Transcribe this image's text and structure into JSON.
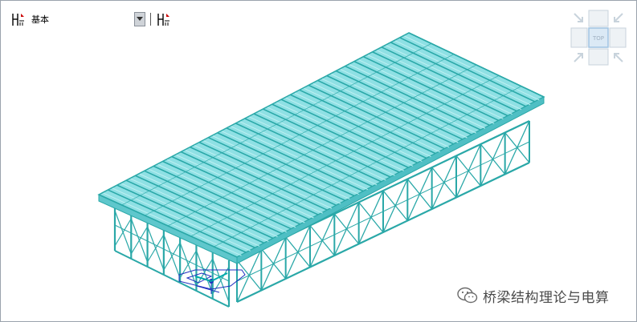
{
  "toolbar": {
    "style_label": "基本"
  },
  "navcube": {
    "face_label": "TOP"
  },
  "watermark": {
    "text": "桥梁结构理论与电算"
  },
  "colors": {
    "model": "#2aa8a8",
    "deck": "#8fe0e4",
    "axis": "#1f2fbf",
    "navcube": "#cfe6f7"
  },
  "icons": [
    "level-icon",
    "dropdown-arrow-icon",
    "level-alt-icon",
    "wechat-icon"
  ]
}
